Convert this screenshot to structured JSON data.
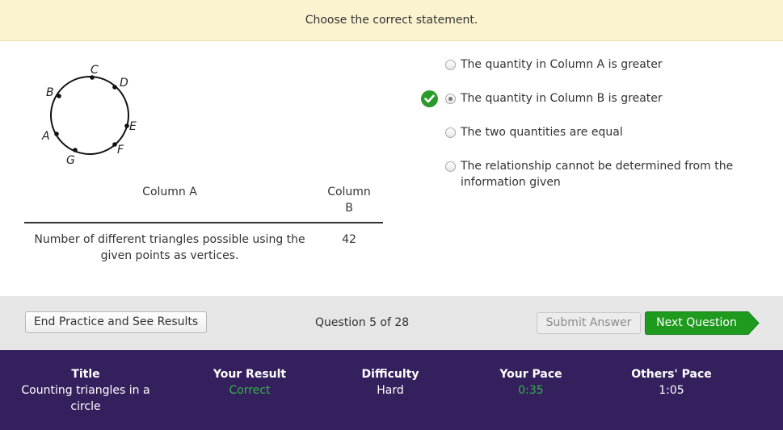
{
  "prompt": "Choose the correct statement.",
  "figure": {
    "points": [
      "C",
      "D",
      "E",
      "F",
      "G",
      "A",
      "B"
    ]
  },
  "comparison": {
    "column_a_header": "Column A",
    "column_b_header_line1": "Column",
    "column_b_header_line2": "B",
    "column_a_line1": "Number of different triangles possible using the",
    "column_a_line2": "given points as vertices.",
    "column_b_value": "42"
  },
  "choices": [
    {
      "label": "The quantity in Column A is greater",
      "selected": false
    },
    {
      "label": "The quantity in Column B is greater",
      "selected": true
    },
    {
      "label": "The two quantities are equal",
      "selected": false
    },
    {
      "label_line1": "The relationship cannot be determined from the",
      "label_line2": "information given",
      "selected": false
    }
  ],
  "actions": {
    "end_label": "End Practice and See Results",
    "question_counter": "Question 5 of 28",
    "submit_label": "Submit Answer",
    "next_label": "Next Question"
  },
  "stats": {
    "title_label": "Title",
    "title_line1": "Counting triangles in a",
    "title_line2": "circle",
    "result_label": "Your Result",
    "result_value": "Correct",
    "difficulty_label": "Difficulty",
    "difficulty_value": "Hard",
    "pace_label": "Your Pace",
    "pace_value": "0:35",
    "others_label": "Others' Pace",
    "others_value": "1:05"
  },
  "colors": {
    "prompt_bg": "#fbf3cf",
    "stats_bg": "#35205e",
    "correct_green": "#34b24a",
    "next_button": "#1e9a1e",
    "check_badge": "#2a9a2a"
  }
}
